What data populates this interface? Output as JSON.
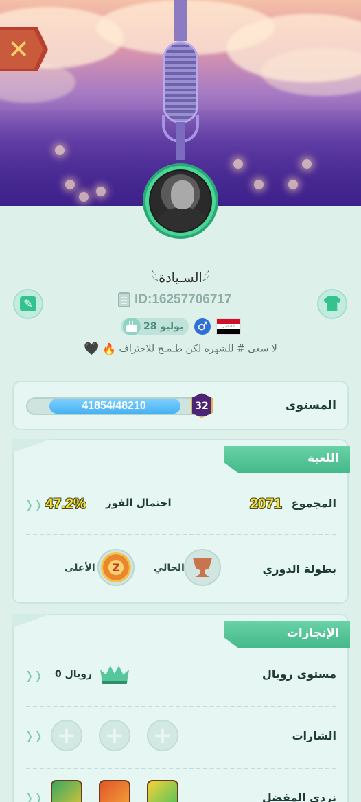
{
  "profile": {
    "username": "𓆩السـيادة𓆪",
    "id_text": "ID:16257706717",
    "birthday": "28 يوليو",
    "gender_symbol": "♂",
    "flag_text": "الله اكبر",
    "bio": "لا سعى # للشهره لكن طـمـح للاحتراف",
    "bio_fire": "🔥",
    "bio_heart": "🖤"
  },
  "level": {
    "label": "المستوى",
    "progress_text": "41854/48210",
    "current": 41854,
    "max": 48210,
    "badge": "32"
  },
  "game": {
    "title": "اللعبة",
    "total_label": "المجموع",
    "total_value": "2071",
    "win_label": "احتمال الفوز",
    "win_value": "47.2%",
    "league_label": "بطولة الدوري",
    "current_label": "الحالي",
    "highest_label": "الأعلى",
    "medal_text": "Z"
  },
  "achievements": {
    "title": "الإنجازات",
    "royal_label": "مستوى رويال",
    "royal_value": "رويال 0",
    "badges_label": "الشارات",
    "dice_label": "نردي المفضل",
    "plus": "+"
  },
  "icons": {
    "close": "✕",
    "arrow": "❭❭",
    "edit": "✎"
  },
  "colors": {
    "accent_green": "#44b88a",
    "background": "#def0ea",
    "progress_blue": "#46b2f3",
    "close_red": "#c95a3c"
  }
}
